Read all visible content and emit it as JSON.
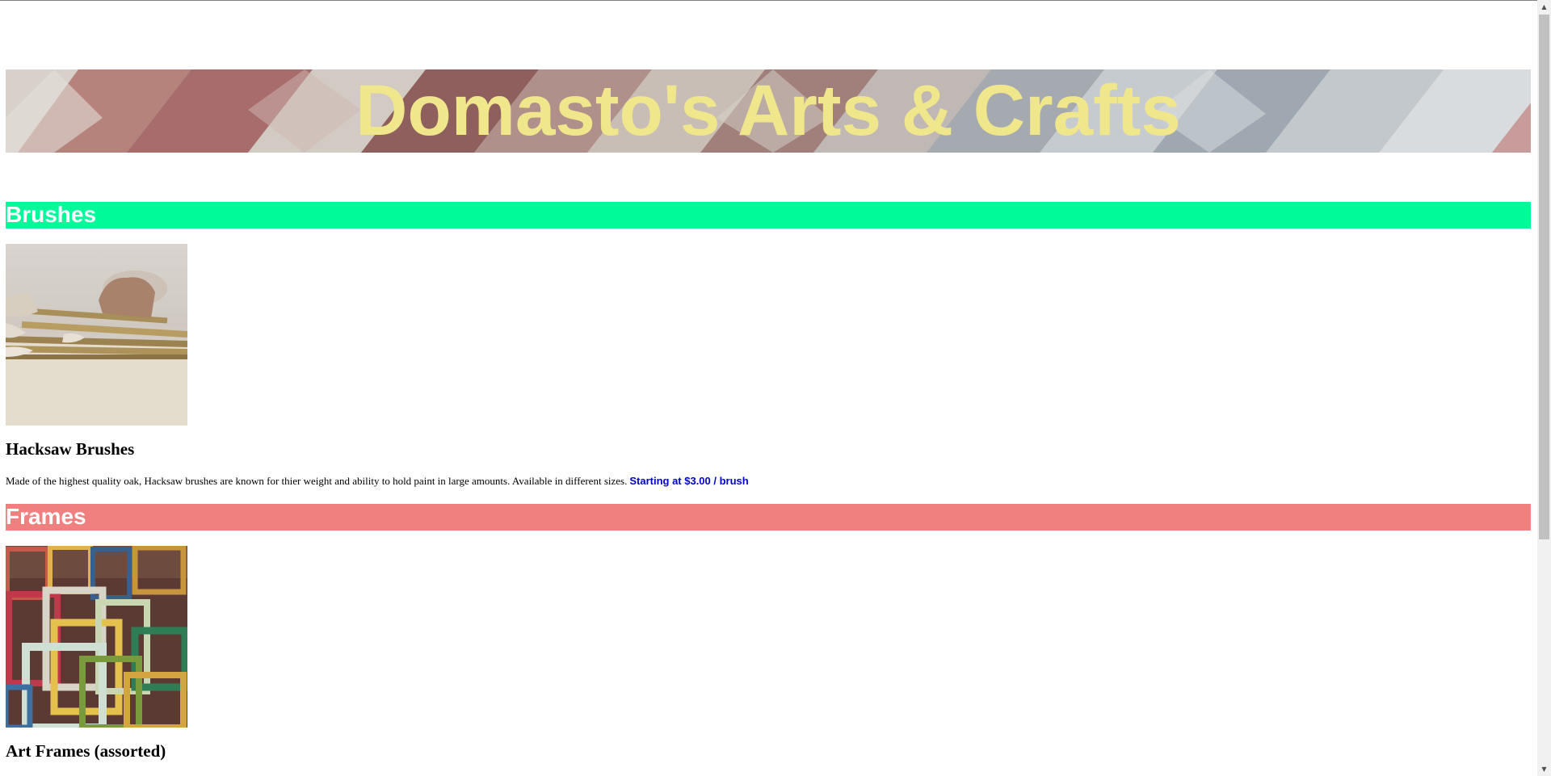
{
  "header": {
    "title": "Domasto's Arts & Crafts"
  },
  "sections": [
    {
      "heading": "Brushes",
      "color": "#00fa9a",
      "product": {
        "image": "paint-brushes-photo",
        "name": "Hacksaw Brushes",
        "description": "Made of the highest quality oak, Hacksaw brushes are known for thier weight and ability to hold paint in large amounts. Available in different sizes.",
        "price": "Starting at $3.00 / brush"
      }
    },
    {
      "heading": "Frames",
      "color": "#f08080",
      "product": {
        "image": "art-frames-photo",
        "name": "Art Frames (assorted)"
      }
    }
  ],
  "colors": {
    "title": "#f0e68c",
    "price": "#0000cd"
  },
  "icons": {
    "scroll_up": "▲",
    "scroll_down": "▼"
  }
}
